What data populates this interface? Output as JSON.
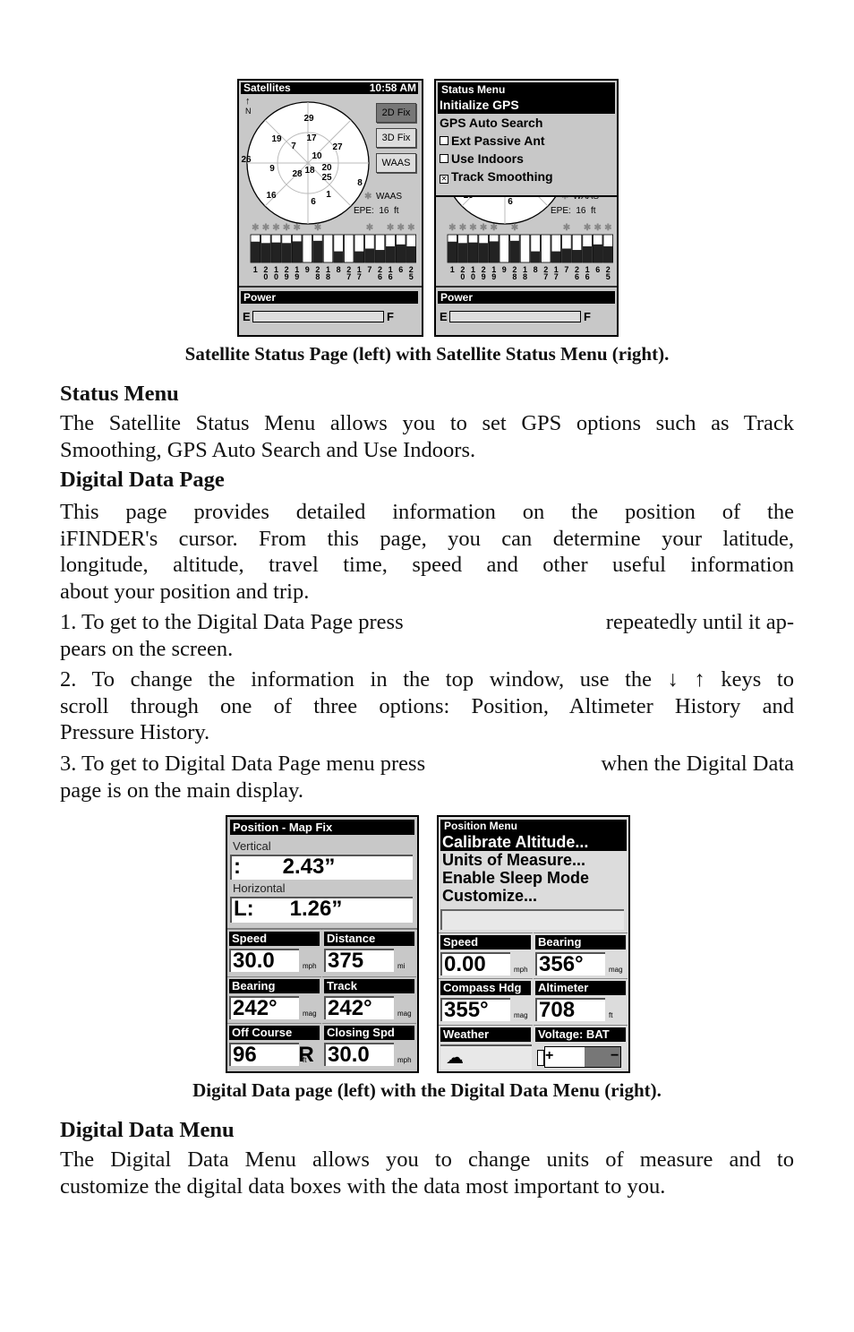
{
  "figure1": {
    "caption": "Satellite Status Page (left) with Satellite Status Menu (right).",
    "sat_screen": {
      "title": "Satellites",
      "time": "10:58 AM",
      "north": "N",
      "buttons": [
        "2D Fix",
        "3D Fix",
        "WAAS"
      ],
      "sky_sats": [
        "29",
        "19",
        "7",
        "17",
        "27",
        "10",
        "26",
        "9",
        "28",
        "18",
        "20",
        "25",
        "8",
        "16",
        "6",
        "1"
      ],
      "waas_label": "WAAS",
      "epe": "EPE:  16  ft",
      "bar_sats": [
        "1",
        "20",
        "10",
        "29",
        "19",
        "9",
        "28",
        "18",
        "8",
        "27",
        "17",
        "7",
        "26",
        "16",
        "6",
        "25"
      ],
      "bar_levels": [
        0.75,
        0.7,
        0.72,
        0.7,
        0.76,
        0,
        0.78,
        0,
        0.4,
        0,
        0.4,
        0.5,
        0.45,
        0.58,
        0.65,
        0.58
      ],
      "bar_stars": [
        true,
        true,
        true,
        true,
        true,
        false,
        true,
        false,
        false,
        false,
        false,
        true,
        false,
        true,
        true,
        true
      ],
      "power_label": "Power",
      "empty": "E",
      "full": "F"
    },
    "status_menu": {
      "title": "Status Menu",
      "items": [
        {
          "label": "Initialize GPS",
          "selected": true
        },
        {
          "label": "GPS Auto Search"
        },
        {
          "label": "Ext Passive Ant",
          "checkbox": true,
          "checked": false
        },
        {
          "label": "Use Indoors",
          "checkbox": true,
          "checked": false
        },
        {
          "label": "Track Smoothing",
          "checkbox": true,
          "checked": true
        }
      ]
    }
  },
  "sections": {
    "status_menu": {
      "heading": "Status Menu",
      "lines": [
        "The Satellite Status Menu allows you to set GPS options such as Track",
        "Smoothing, GPS Auto Search and Use Indoors."
      ]
    },
    "digital_page": {
      "heading": "Digital Data Page",
      "lines": [
        "This page provides detailed information on the position of the",
        "iFINDER's cursor. From this page, you can determine your latitude,",
        "longitude, altitude, travel time, speed and other useful information",
        "about your position and trip."
      ],
      "step1": {
        "a": "1. To get to the Digital Data Page press",
        "b": "repeatedly until it ap-",
        "c": "pears on the screen."
      },
      "step2": [
        "2. To change the information in the top window, use the ↓ ↑ keys to",
        "scroll through one of three options: Position, Altimeter History and",
        "Pressure History."
      ],
      "step3": {
        "a": "3. To get to Digital Data Page menu press",
        "b": "when the Digital Data",
        "c": "page is on the main display."
      }
    },
    "digital_menu": {
      "heading": "Digital Data Menu",
      "lines": [
        "The Digital Data Menu allows you to change units of measure and to",
        "customize the digital data boxes with the data most important to you."
      ]
    }
  },
  "figure2": {
    "caption": "Digital Data page (left) with the Digital Data Menu (right).",
    "data_page": {
      "title": "Position - Map Fix",
      "vertical_label": "Vertical",
      "vertical_value": ":       2.43”",
      "horizontal_label": "Horizontal",
      "horizontal_value": "L:      1.26”",
      "cells": [
        {
          "label": "Speed",
          "value": "30.0",
          "unit": "mph"
        },
        {
          "label": "Distance",
          "value": "375",
          "unit": "mi"
        },
        {
          "label": "Bearing",
          "value": "242°",
          "unit": "mag"
        },
        {
          "label": "Track",
          "value": "242°",
          "unit": "mag"
        },
        {
          "label": "Off Course",
          "value": "96       R",
          "unit": "ft"
        },
        {
          "label": "Closing Spd",
          "value": "30.0",
          "unit": "mph"
        }
      ]
    },
    "position_menu": {
      "title": "Position Menu",
      "items": [
        "Calibrate Altitude...",
        "Units of Measure...",
        "Enable Sleep Mode",
        "Customize..."
      ],
      "cells": [
        {
          "label": "Speed",
          "value": "0.00",
          "unit": "mph"
        },
        {
          "label": "Bearing",
          "value": "356°",
          "unit": "mag"
        },
        {
          "label": "Compass Hdg",
          "value": "355°",
          "unit": "mag"
        },
        {
          "label": "Altimeter",
          "value": "708",
          "unit": "ft"
        },
        {
          "label": "Weather",
          "icon": "rain-cloud-icon"
        },
        {
          "label": "Voltage: BAT",
          "icon": "battery-icon",
          "plus": "+",
          "minus": "−"
        }
      ]
    }
  }
}
